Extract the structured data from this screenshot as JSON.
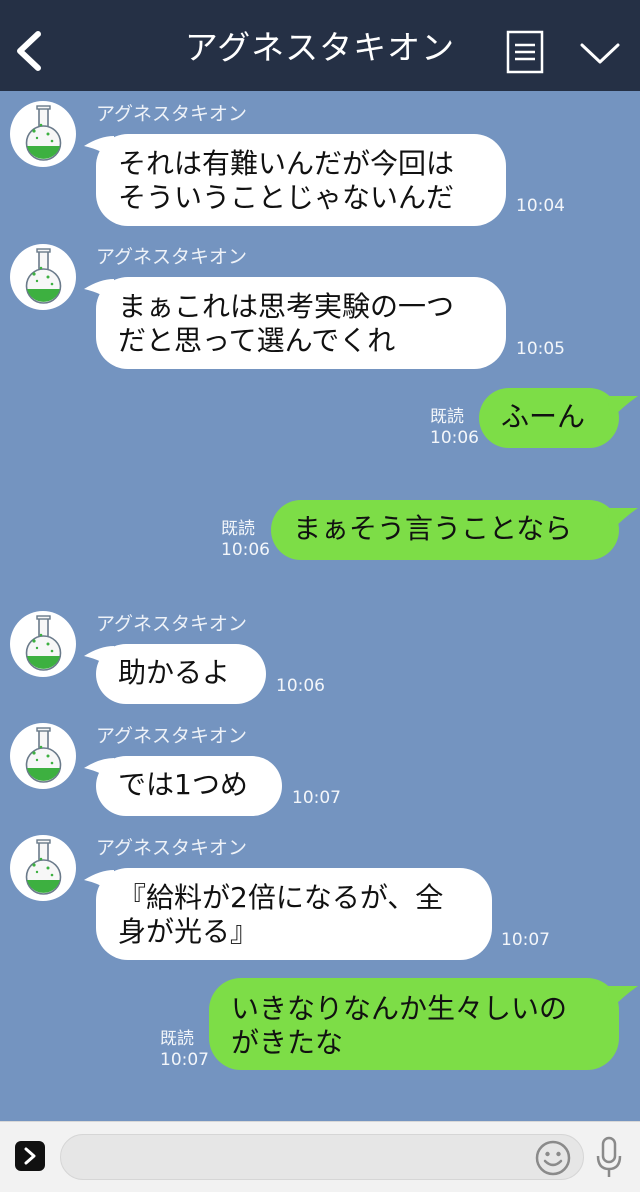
{
  "header": {
    "title": "アグネスタキオン"
  },
  "messages": [
    {
      "sender": "アグネスタキオン",
      "text": "それは有難いんだが今回は\nそういうことじゃないんだ",
      "time": "10:04"
    },
    {
      "sender": "アグネスタキオン",
      "text": "まぁこれは思考実験の一つ\nだと思って選んでくれ",
      "time": "10:05"
    },
    {
      "text": "ふーん",
      "read": "既読",
      "time": "10:06"
    },
    {
      "text": "まぁそう言うことなら",
      "read": "既読",
      "time": "10:06"
    },
    {
      "sender": "アグネスタキオン",
      "text": "助かるよ",
      "time": "10:06"
    },
    {
      "sender": "アグネスタキオン",
      "text": "では1つめ",
      "time": "10:07"
    },
    {
      "sender": "アグネスタキオン",
      "text": "『給料が2倍になるが、全\n身が光る』",
      "time": "10:07"
    },
    {
      "text": "いきなりなんか生々しいの\nがきたな",
      "read": "既読",
      "time": "10:07"
    }
  ],
  "input": {
    "value": ""
  },
  "colors": {
    "background": "#7494c0",
    "header": "#253045",
    "outgoing": "#7ddd47",
    "incoming": "#ffffff"
  },
  "icons": [
    "chevron-left-icon",
    "menu-icon",
    "chevron-down-icon",
    "flask-icon",
    "expand-icon",
    "emoji-icon",
    "mic-icon"
  ]
}
